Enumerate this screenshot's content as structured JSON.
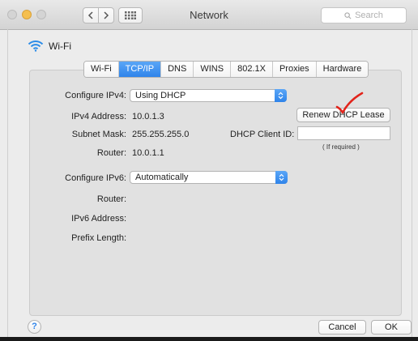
{
  "window": {
    "title": "Network",
    "search_placeholder": "Search"
  },
  "header": {
    "interface_name": "Wi-Fi"
  },
  "tabs": [
    {
      "label": "Wi-Fi",
      "active": false
    },
    {
      "label": "TCP/IP",
      "active": true
    },
    {
      "label": "DNS",
      "active": false
    },
    {
      "label": "WINS",
      "active": false
    },
    {
      "label": "802.1X",
      "active": false
    },
    {
      "label": "Proxies",
      "active": false
    },
    {
      "label": "Hardware",
      "active": false
    }
  ],
  "ipv4": {
    "configure_label": "Configure IPv4:",
    "configure_value": "Using DHCP",
    "address_label": "IPv4 Address:",
    "address_value": "10.0.1.3",
    "subnet_label": "Subnet Mask:",
    "subnet_value": "255.255.255.0",
    "router_label": "Router:",
    "router_value": "10.0.1.1",
    "renew_button": "Renew DHCP Lease",
    "client_id_label": "DHCP Client ID:",
    "client_id_value": "",
    "client_id_hint": "( If required )"
  },
  "ipv6": {
    "configure_label": "Configure IPv6:",
    "configure_value": "Automatically",
    "router_label": "Router:",
    "address_label": "IPv6 Address:",
    "prefix_label": "Prefix Length:"
  },
  "footer": {
    "help": "?",
    "cancel": "Cancel",
    "ok": "OK"
  },
  "colors": {
    "accent": "#2f84ea",
    "annotation": "#e2231a",
    "wifi_icon": "#2b8ce8"
  },
  "icons": [
    "back-icon",
    "forward-icon",
    "grid-icon",
    "search-icon",
    "wifi-icon",
    "popup-arrows-icon",
    "checkmark-annotation"
  ]
}
